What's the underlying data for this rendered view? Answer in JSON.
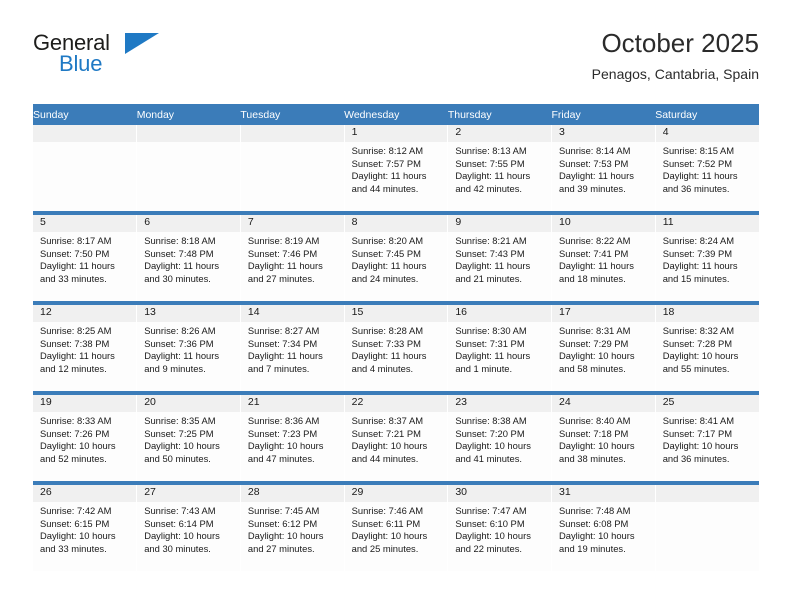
{
  "brand": {
    "name_top": "General",
    "name_bottom": "Blue",
    "triangle_icon": "blue-triangle-logo-mark",
    "accent_color": "#1f79c4"
  },
  "header": {
    "title": "October 2025",
    "subtitle": "Penagos, Cantabria, Spain"
  },
  "theme": {
    "header_row_bg": "#3b7cb9",
    "daynum_bg": "#f0f0f0",
    "cell_bg": "#fdfdfd",
    "text_color": "#1a1a1a"
  },
  "weekday_headers": [
    "Sunday",
    "Monday",
    "Tuesday",
    "Wednesday",
    "Thursday",
    "Friday",
    "Saturday"
  ],
  "weeks": [
    [
      {
        "day": "",
        "lines": []
      },
      {
        "day": "",
        "lines": []
      },
      {
        "day": "",
        "lines": []
      },
      {
        "day": "1",
        "lines": [
          "Sunrise: 8:12 AM",
          "Sunset: 7:57 PM",
          "Daylight: 11 hours",
          "and 44 minutes."
        ]
      },
      {
        "day": "2",
        "lines": [
          "Sunrise: 8:13 AM",
          "Sunset: 7:55 PM",
          "Daylight: 11 hours",
          "and 42 minutes."
        ]
      },
      {
        "day": "3",
        "lines": [
          "Sunrise: 8:14 AM",
          "Sunset: 7:53 PM",
          "Daylight: 11 hours",
          "and 39 minutes."
        ]
      },
      {
        "day": "4",
        "lines": [
          "Sunrise: 8:15 AM",
          "Sunset: 7:52 PM",
          "Daylight: 11 hours",
          "and 36 minutes."
        ]
      }
    ],
    [
      {
        "day": "5",
        "lines": [
          "Sunrise: 8:17 AM",
          "Sunset: 7:50 PM",
          "Daylight: 11 hours",
          "and 33 minutes."
        ]
      },
      {
        "day": "6",
        "lines": [
          "Sunrise: 8:18 AM",
          "Sunset: 7:48 PM",
          "Daylight: 11 hours",
          "and 30 minutes."
        ]
      },
      {
        "day": "7",
        "lines": [
          "Sunrise: 8:19 AM",
          "Sunset: 7:46 PM",
          "Daylight: 11 hours",
          "and 27 minutes."
        ]
      },
      {
        "day": "8",
        "lines": [
          "Sunrise: 8:20 AM",
          "Sunset: 7:45 PM",
          "Daylight: 11 hours",
          "and 24 minutes."
        ]
      },
      {
        "day": "9",
        "lines": [
          "Sunrise: 8:21 AM",
          "Sunset: 7:43 PM",
          "Daylight: 11 hours",
          "and 21 minutes."
        ]
      },
      {
        "day": "10",
        "lines": [
          "Sunrise: 8:22 AM",
          "Sunset: 7:41 PM",
          "Daylight: 11 hours",
          "and 18 minutes."
        ]
      },
      {
        "day": "11",
        "lines": [
          "Sunrise: 8:24 AM",
          "Sunset: 7:39 PM",
          "Daylight: 11 hours",
          "and 15 minutes."
        ]
      }
    ],
    [
      {
        "day": "12",
        "lines": [
          "Sunrise: 8:25 AM",
          "Sunset: 7:38 PM",
          "Daylight: 11 hours",
          "and 12 minutes."
        ]
      },
      {
        "day": "13",
        "lines": [
          "Sunrise: 8:26 AM",
          "Sunset: 7:36 PM",
          "Daylight: 11 hours",
          "and 9 minutes."
        ]
      },
      {
        "day": "14",
        "lines": [
          "Sunrise: 8:27 AM",
          "Sunset: 7:34 PM",
          "Daylight: 11 hours",
          "and 7 minutes."
        ]
      },
      {
        "day": "15",
        "lines": [
          "Sunrise: 8:28 AM",
          "Sunset: 7:33 PM",
          "Daylight: 11 hours",
          "and 4 minutes."
        ]
      },
      {
        "day": "16",
        "lines": [
          "Sunrise: 8:30 AM",
          "Sunset: 7:31 PM",
          "Daylight: 11 hours",
          "and 1 minute."
        ]
      },
      {
        "day": "17",
        "lines": [
          "Sunrise: 8:31 AM",
          "Sunset: 7:29 PM",
          "Daylight: 10 hours",
          "and 58 minutes."
        ]
      },
      {
        "day": "18",
        "lines": [
          "Sunrise: 8:32 AM",
          "Sunset: 7:28 PM",
          "Daylight: 10 hours",
          "and 55 minutes."
        ]
      }
    ],
    [
      {
        "day": "19",
        "lines": [
          "Sunrise: 8:33 AM",
          "Sunset: 7:26 PM",
          "Daylight: 10 hours",
          "and 52 minutes."
        ]
      },
      {
        "day": "20",
        "lines": [
          "Sunrise: 8:35 AM",
          "Sunset: 7:25 PM",
          "Daylight: 10 hours",
          "and 50 minutes."
        ]
      },
      {
        "day": "21",
        "lines": [
          "Sunrise: 8:36 AM",
          "Sunset: 7:23 PM",
          "Daylight: 10 hours",
          "and 47 minutes."
        ]
      },
      {
        "day": "22",
        "lines": [
          "Sunrise: 8:37 AM",
          "Sunset: 7:21 PM",
          "Daylight: 10 hours",
          "and 44 minutes."
        ]
      },
      {
        "day": "23",
        "lines": [
          "Sunrise: 8:38 AM",
          "Sunset: 7:20 PM",
          "Daylight: 10 hours",
          "and 41 minutes."
        ]
      },
      {
        "day": "24",
        "lines": [
          "Sunrise: 8:40 AM",
          "Sunset: 7:18 PM",
          "Daylight: 10 hours",
          "and 38 minutes."
        ]
      },
      {
        "day": "25",
        "lines": [
          "Sunrise: 8:41 AM",
          "Sunset: 7:17 PM",
          "Daylight: 10 hours",
          "and 36 minutes."
        ]
      }
    ],
    [
      {
        "day": "26",
        "lines": [
          "Sunrise: 7:42 AM",
          "Sunset: 6:15 PM",
          "Daylight: 10 hours",
          "and 33 minutes."
        ]
      },
      {
        "day": "27",
        "lines": [
          "Sunrise: 7:43 AM",
          "Sunset: 6:14 PM",
          "Daylight: 10 hours",
          "and 30 minutes."
        ]
      },
      {
        "day": "28",
        "lines": [
          "Sunrise: 7:45 AM",
          "Sunset: 6:12 PM",
          "Daylight: 10 hours",
          "and 27 minutes."
        ]
      },
      {
        "day": "29",
        "lines": [
          "Sunrise: 7:46 AM",
          "Sunset: 6:11 PM",
          "Daylight: 10 hours",
          "and 25 minutes."
        ]
      },
      {
        "day": "30",
        "lines": [
          "Sunrise: 7:47 AM",
          "Sunset: 6:10 PM",
          "Daylight: 10 hours",
          "and 22 minutes."
        ]
      },
      {
        "day": "31",
        "lines": [
          "Sunrise: 7:48 AM",
          "Sunset: 6:08 PM",
          "Daylight: 10 hours",
          "and 19 minutes."
        ]
      },
      {
        "day": "",
        "lines": []
      }
    ]
  ]
}
